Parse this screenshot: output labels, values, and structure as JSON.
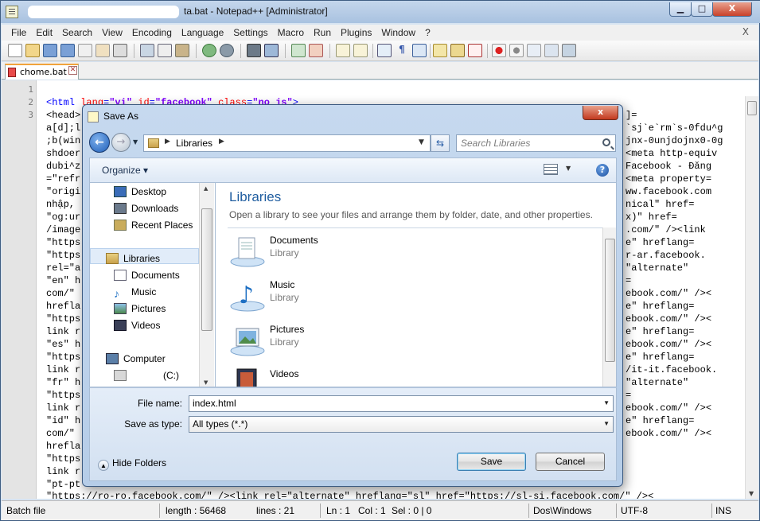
{
  "window": {
    "title": "chome.bat - Notepad++ [Administrator]",
    "title_visible": "ta.bat - Notepad++ [Administrator]",
    "min": "▁",
    "max": "□",
    "close": "X"
  },
  "menu": [
    "File",
    "Edit",
    "Search",
    "View",
    "Encoding",
    "Language",
    "Settings",
    "Macro",
    "Run",
    "Plugins",
    "Window",
    "?"
  ],
  "menu_close": "X",
  "tab": {
    "label": "chome.bat",
    "close": "✕"
  },
  "editor": {
    "line_numbers": [
      "1",
      "2",
      "3"
    ],
    "line2": {
      "tag_open": "<html ",
      "lang_attr": "lang",
      "lang_val": "\"vi\"",
      "id_attr": "id",
      "id_val": "\"facebook\"",
      "class_attr": "class",
      "class_val": "\"no js\"",
      "tag_close": ">"
    },
    "left_fragments": [
      "<head>",
      "a[d];l",
      ";b(win",
      "shdoer",
      "dubi^z",
      "=\"refr",
      "\"origi",
      "nhập, ",
      "\"og:ur",
      "/image",
      "\"https",
      "\"https",
      "rel=\"a",
      "\"en\" h",
      "com/\"",
      "hrefla",
      "\"https",
      "link r",
      "\"es\" h",
      "\"https",
      "link r",
      "\"fr\" h",
      "\"https",
      "link r",
      "\"id\" h",
      "com/\"",
      "hrefla",
      "\"https",
      "link r",
      "\"pt-pt"
    ],
    "right_fragments": [
      "]=",
      "`sj`e`rm`s-0fdu^g",
      "jnx-0unjdojnx0-0g",
      "<meta http-equiv",
      "Facebook - Đăng",
      "<meta property=",
      "ww.facebook.com",
      "nical\" href=",
      "x)\" href=",
      ".com/\" /><link",
      "e\" hreflang=",
      "r-ar.facebook.",
      "\"alternate\"",
      "=",
      "ebook.com/\" /><",
      "e\" hreflang=",
      "ebook.com/\" /><",
      "e\" hreflang=",
      "ebook.com/\" /><",
      "e\" hreflang=",
      "/it-it.facebook.",
      "\"alternate\"",
      "=",
      "ebook.com/\" /><",
      "e\" hreflang=",
      "ebook.com/\" /><"
    ],
    "bottom_line": "\"https://ro-ro.facebook.com/\" /><link rel=\"alternate\" hreflang=\"sl\" href=\"https://sl-si.facebook.com/\" /><"
  },
  "status": {
    "file_type": "Batch file",
    "length": "length : 56468",
    "lines": "lines : 21",
    "ln": "Ln : 1",
    "col": "Col : 1",
    "sel": "Sel : 0 | 0",
    "eol": "Dos\\Windows",
    "encoding": "UTF-8",
    "mode": "INS"
  },
  "dialog": {
    "title": "Save As",
    "close": "x",
    "address_path": "Libraries",
    "search_placeholder": "Search Libraries",
    "organize": "Organize ▾",
    "nav_items": [
      {
        "label": "Desktop",
        "icon": "desktop-icon"
      },
      {
        "label": "Downloads",
        "icon": "downloads-icon"
      },
      {
        "label": "Recent Places",
        "icon": "recent-places-icon"
      },
      {
        "label": "Libraries",
        "icon": "libraries-icon"
      },
      {
        "label": "Documents",
        "icon": "documents-icon"
      },
      {
        "label": "Music",
        "icon": "music-icon"
      },
      {
        "label": "Pictures",
        "icon": "pictures-icon"
      },
      {
        "label": "Videos",
        "icon": "videos-icon"
      },
      {
        "label": "Computer",
        "icon": "computer-icon"
      },
      {
        "label": "(C:)",
        "icon": "drive-icon"
      }
    ],
    "heading": "Libraries",
    "subheading": "Open a library to see your files and arrange them by folder, date, and other properties.",
    "libraries": [
      {
        "name": "Documents",
        "type": "Library",
        "icon": "documents-library-icon"
      },
      {
        "name": "Music",
        "type": "Library",
        "icon": "music-library-icon"
      },
      {
        "name": "Pictures",
        "type": "Library",
        "icon": "pictures-library-icon"
      },
      {
        "name": "Videos",
        "type": "Library",
        "icon": "videos-library-icon"
      }
    ],
    "file_name_label": "File name:",
    "file_name_value": "index.html",
    "save_type_label": "Save as type:",
    "save_type_value": "All types (*.*)",
    "hide_folders": "Hide Folders",
    "save_button": "Save",
    "cancel_button": "Cancel"
  }
}
